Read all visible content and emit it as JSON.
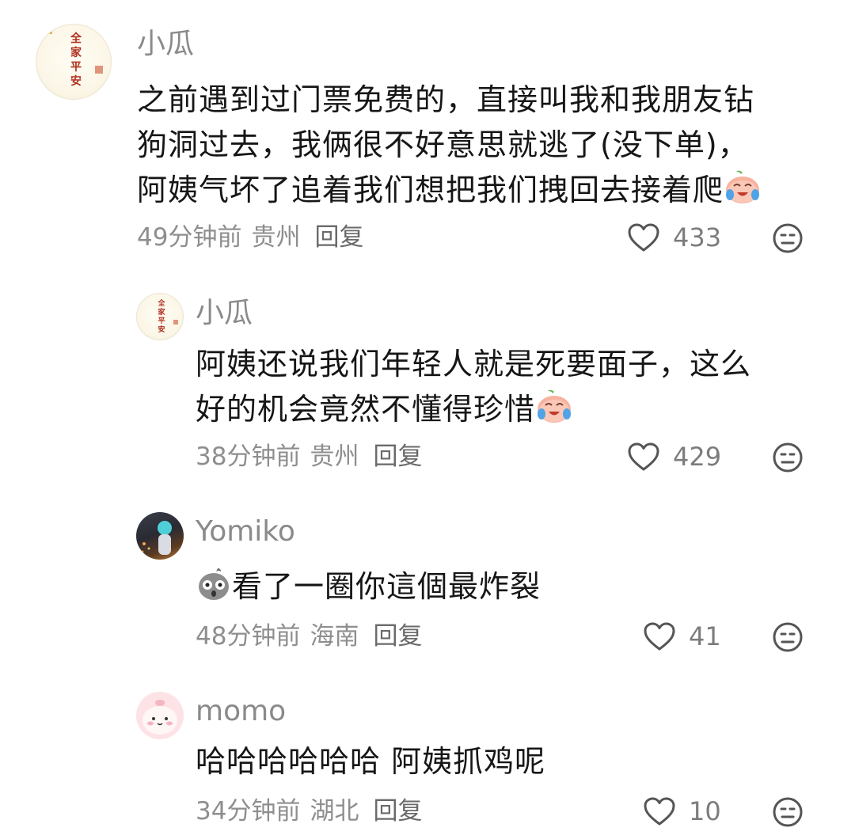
{
  "comments": [
    {
      "username": "小瓜",
      "avatar_text": [
        "全",
        "家",
        "平",
        "安"
      ],
      "lines": [
        "之前遇到过门票免费的，直接叫我和我朋友钻",
        "狗洞过去，我俩很不好意思就逃了(没下单)，",
        "阿姨气坏了追着我们想把我们拽回去接着爬"
      ],
      "time": "49分钟前",
      "location": "贵州",
      "reply_label": "回复",
      "likes": "433"
    },
    {
      "username": "小瓜",
      "avatar_text": [
        "全",
        "家",
        "平",
        "安"
      ],
      "lines": [
        "阿姨还说我们年轻人就是死要面子，这么",
        "好的机会竟然不懂得珍惜"
      ],
      "time": "38分钟前",
      "location": "贵州",
      "reply_label": "回复",
      "likes": "429"
    },
    {
      "username": "Yomiko",
      "lines": [
        "看了一圈你這個最炸裂"
      ],
      "time": "48分钟前",
      "location": "海南",
      "reply_label": "回复",
      "likes": "41"
    },
    {
      "username": "momo",
      "lines": [
        "哈哈哈哈哈哈 阿姨抓鸡呢"
      ],
      "time": "34分钟前",
      "location": "湖北",
      "reply_label": "回复",
      "likes": "10"
    }
  ],
  "icons": {
    "like": "heart-outline-icon",
    "dislike": "meh-face-icon",
    "cry_laugh_emoji": "crying-laughing-peach-emoji",
    "shock_emoji": "shocked-gray-emoji"
  },
  "colors": {
    "text": "#161616",
    "username": "#8a8a8a",
    "meta": "#8e8e8e",
    "icon": "#555555",
    "seal": "#c0392b"
  }
}
